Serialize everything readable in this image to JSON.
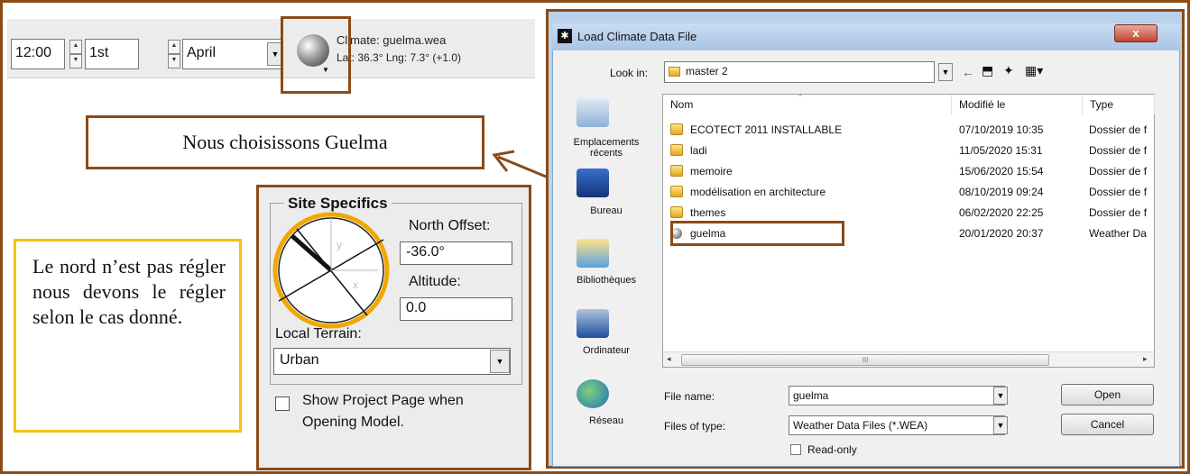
{
  "toolbar": {
    "time": "12:00",
    "day": "1st",
    "month": "April",
    "climate_label": "Climate: guelma.wea",
    "location": "Lat: 36.3°     Lng: 7.3° (+1.0)"
  },
  "callouts": {
    "choose_guelma": "Nous choisissons Guelma",
    "north_note": "Le nord n’est pas régler nous devons le régler selon le cas donné."
  },
  "site": {
    "title": "Site Specifics",
    "north_offset_label": "North Offset:",
    "north_offset_value": "-36.0°",
    "altitude_label": "Altitude:",
    "altitude_value": "0.0",
    "terrain_label": "Local Terrain:",
    "terrain_value": "Urban",
    "show_project_label": "Show Project Page when",
    "show_project_label2": "Opening Model.",
    "compass_x": "x",
    "compass_y": "y"
  },
  "dialog": {
    "title": "Load Climate Data File",
    "close": "x",
    "look_in_label": "Look in:",
    "look_in_value": "master 2",
    "places": [
      {
        "label": "Emplacements récents"
      },
      {
        "label": "Bureau"
      },
      {
        "label": "Bibliothèques"
      },
      {
        "label": "Ordinateur"
      },
      {
        "label": "Réseau"
      }
    ],
    "columns": [
      "Nom",
      "Modifié le",
      "Type"
    ],
    "files": [
      {
        "name": "ECOTECT 2011 INSTALLABLE",
        "date": "07/10/2019 10:35",
        "type": "Dossier de f"
      },
      {
        "name": "ladi",
        "date": "11/05/2020 15:31",
        "type": "Dossier de f"
      },
      {
        "name": "memoire",
        "date": "15/06/2020 15:54",
        "type": "Dossier de f"
      },
      {
        "name": "modélisation en architecture",
        "date": "08/10/2019 09:24",
        "type": "Dossier de f"
      },
      {
        "name": "themes",
        "date": "06/02/2020 22:25",
        "type": "Dossier de f"
      },
      {
        "name": "guelma",
        "date": "20/01/2020 20:37",
        "type": "Weather Da"
      }
    ],
    "file_name_label": "File name:",
    "file_name_value": "guelma",
    "file_type_label": "Files of type:",
    "file_type_value": "Weather Data Files (*.WEA)",
    "readonly_label": "Read-only",
    "open_label": "Open",
    "cancel_label": "Cancel",
    "scroll_mark": "III"
  },
  "colors": {
    "frame": "#8b4b17",
    "callout_yellow": "#f5c211",
    "compass_ring": "#f0a800"
  }
}
